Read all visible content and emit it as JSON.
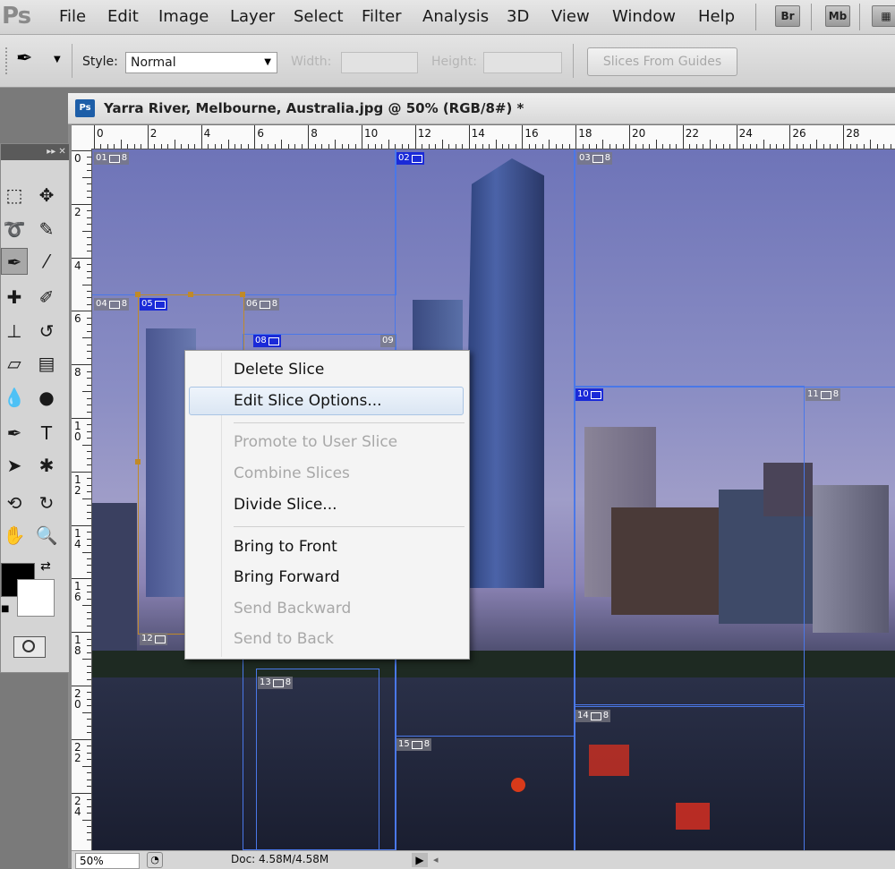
{
  "menubar": {
    "logo": "Ps",
    "items": [
      "File",
      "Edit",
      "Image",
      "Layer",
      "Select",
      "Filter",
      "Analysis",
      "3D",
      "View",
      "Window",
      "Help"
    ],
    "bridge_label": "Br",
    "minibridge_label": "Mb"
  },
  "options": {
    "style_label": "Style:",
    "style_value": "Normal",
    "width_label": "Width:",
    "height_label": "Height:",
    "slices_from_guides": "Slices From Guides"
  },
  "document": {
    "badge": "Ps",
    "title": "Yarra River, Melbourne, Australia.jpg @ 50% (RGB/8#) *"
  },
  "ruler": {
    "top_labels": [
      "0",
      "2",
      "4",
      "6",
      "8",
      "10",
      "12",
      "14",
      "16",
      "18",
      "20",
      "22",
      "24",
      "26",
      "28"
    ],
    "left_labels": [
      "0",
      "2",
      "4",
      "6",
      "8",
      "10",
      "12",
      "14",
      "16",
      "18",
      "20",
      "22",
      "24"
    ]
  },
  "slices": [
    {
      "num": "01",
      "type": "auto"
    },
    {
      "num": "02",
      "type": "user"
    },
    {
      "num": "03",
      "type": "auto"
    },
    {
      "num": "04",
      "type": "auto"
    },
    {
      "num": "05",
      "type": "user"
    },
    {
      "num": "06",
      "type": "auto"
    },
    {
      "num": "08",
      "type": "user"
    },
    {
      "num": "09",
      "type": "auto"
    },
    {
      "num": "10",
      "type": "user"
    },
    {
      "num": "11",
      "type": "auto"
    },
    {
      "num": "12",
      "type": "auto"
    },
    {
      "num": "13",
      "type": "auto"
    },
    {
      "num": "14",
      "type": "auto"
    },
    {
      "num": "15",
      "type": "auto"
    }
  ],
  "context_menu": {
    "items": [
      {
        "label": "Delete Slice",
        "enabled": true
      },
      {
        "label": "Edit Slice Options...",
        "enabled": true,
        "highlighted": true
      },
      {
        "label": "Promote to User Slice",
        "enabled": false
      },
      {
        "label": "Combine Slices",
        "enabled": false
      },
      {
        "label": "Divide Slice...",
        "enabled": true
      },
      {
        "label": "Bring to Front",
        "enabled": true
      },
      {
        "label": "Bring Forward",
        "enabled": true
      },
      {
        "label": "Send Backward",
        "enabled": false
      },
      {
        "label": "Send to Back",
        "enabled": false
      }
    ]
  },
  "status": {
    "zoom": "50%",
    "doc_info": "Doc: 4.58M/4.58M"
  },
  "colors": {
    "slice_line": "#4a78e8",
    "user_slice_tag": "#1a2ad8",
    "selected_slice": "#c08a28",
    "menu_highlight": "#dbe6f3"
  }
}
